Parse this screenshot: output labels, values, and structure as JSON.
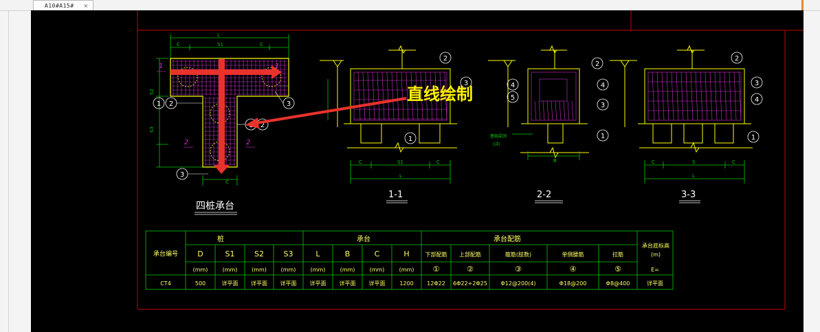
{
  "tab": {
    "title": "A10#A15#",
    "close_glyph": "×"
  },
  "annotation": {
    "label": "直线绘制",
    "color": "#fff200",
    "arrow_color": "#e8322c"
  },
  "colors": {
    "frame": "#cc0000",
    "dim": "#00cc00",
    "outline": "#ffff00",
    "rebar": "#cc33cc",
    "table_text": "#ffff66",
    "caption": "#ffffff"
  },
  "plan": {
    "caption": "四桩承台",
    "dims": {
      "L": "L",
      "S1": "S1",
      "C": "C",
      "S2": "S2",
      "S3": "S3"
    },
    "rebar_marks": [
      "1",
      "2",
      "3",
      "3",
      "1",
      "2",
      "2"
    ]
  },
  "sections": [
    {
      "caption": "1-1",
      "dims": [
        "C",
        "S1",
        "C",
        "L"
      ],
      "marks": [
        "2",
        "3",
        "1"
      ]
    },
    {
      "caption": "2-2",
      "dims": [
        "B"
      ],
      "marks": [
        "2",
        "4",
        "5",
        "4",
        "3",
        "1"
      ],
      "note": [
        "基础梁顶",
        "(详)"
      ]
    },
    {
      "caption": "3-3",
      "dims": [
        "C",
        "S",
        "C",
        "L"
      ],
      "marks": [
        "2",
        "3",
        "4",
        "1"
      ]
    }
  ],
  "table": {
    "group_headers": [
      "桩",
      "承台",
      "承台配筋",
      "承台底标高"
    ],
    "columns": [
      "承台编号",
      "D",
      "S1",
      "S2",
      "S3",
      "L",
      "B",
      "C",
      "H",
      "下部配筋",
      "上部配筋",
      "箍筋(肢数)",
      "单侧腰筋",
      "拉筋"
    ],
    "units": [
      "(mm)",
      "(mm)",
      "(mm)",
      "(mm)",
      "(mm)",
      "(mm)",
      "(mm)",
      "(mm)",
      "①",
      "②",
      "③",
      "④",
      "⑤",
      "E="
    ],
    "elev_unit": "(m)",
    "row": [
      "CT4",
      "500",
      "详平面",
      "详平面",
      "详平面",
      "详平面",
      "详平面",
      "详平面",
      "1200",
      "12Φ22",
      "6Φ22+2Φ25",
      "Φ12@200(4)",
      "Φ18@200",
      "Φ8@400",
      "详平面"
    ]
  }
}
